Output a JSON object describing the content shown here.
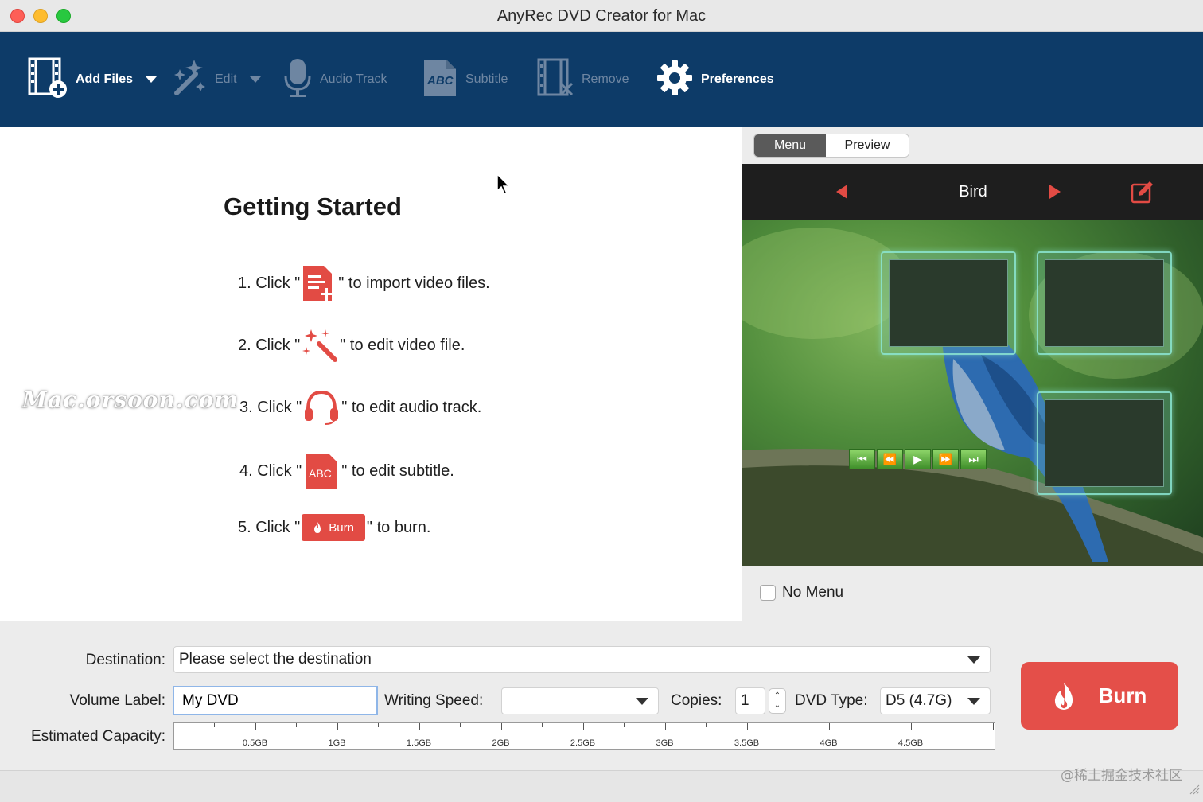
{
  "window": {
    "title": "AnyRec DVD Creator for Mac"
  },
  "toolbar": {
    "add_files": "Add Files",
    "edit": "Edit",
    "audio_track": "Audio Track",
    "subtitle": "Subtitle",
    "remove": "Remove",
    "preferences": "Preferences"
  },
  "getting_started": {
    "title": "Getting Started",
    "steps": [
      {
        "prefix": "1. Click \"",
        "suffix": "\" to import video files."
      },
      {
        "prefix": "2. Click \"",
        "suffix": "\" to edit video file."
      },
      {
        "prefix": "3. Click \"",
        "suffix": "\" to edit audio track."
      },
      {
        "prefix": "4. Click \"",
        "suffix": "\" to edit subtitle."
      },
      {
        "prefix": "5. Click \"",
        "suffix": "\" to burn."
      }
    ],
    "burn_label": "Burn",
    "abc_label": "ABC",
    "watermark": "Mac.orsoon.com"
  },
  "preview_panel": {
    "tabs": [
      "Menu",
      "Preview"
    ],
    "active_tab": "Menu",
    "template_name": "Bird",
    "no_menu": "No Menu"
  },
  "bottom": {
    "destination_label": "Destination:",
    "destination_value": "Please select the destination",
    "volume_label": "Volume Label:",
    "volume_value": "My DVD",
    "writing_speed_label": "Writing Speed:",
    "writing_speed_value": "",
    "copies_label": "Copies:",
    "copies_value": "1",
    "dvd_type_label": "DVD Type:",
    "dvd_type_value": "D5 (4.7G)",
    "capacity_label": "Estimated Capacity:",
    "capacity_ticks": [
      "0.5GB",
      "1GB",
      "1.5GB",
      "2GB",
      "2.5GB",
      "3GB",
      "3.5GB",
      "4GB",
      "4.5GB"
    ],
    "burn_button": "Burn"
  },
  "footer": {
    "watermark": "@稀土掘金技术社区"
  },
  "colors": {
    "toolbar_bg": "#0d3b68",
    "accent_red": "#e44f49"
  }
}
